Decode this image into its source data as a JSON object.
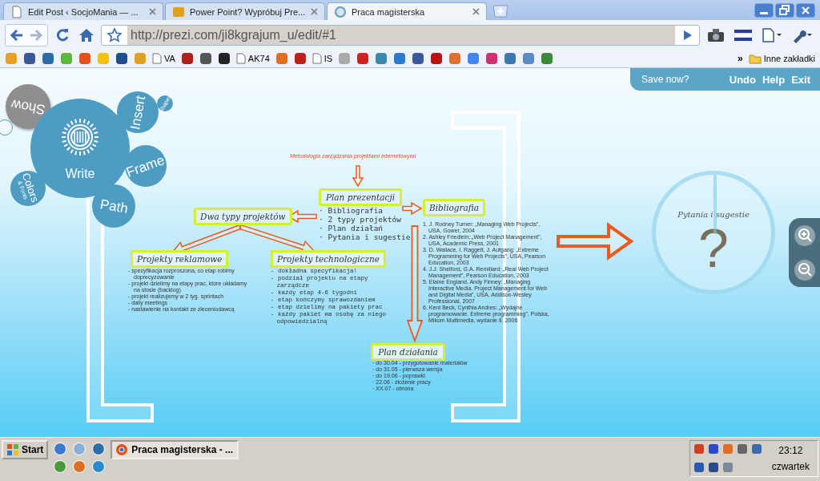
{
  "browser": {
    "tabs": [
      {
        "label": "Edit Post ‹ SocjoMania — ...",
        "selected": false
      },
      {
        "label": "Power Point? Wypróbuj Pre...",
        "selected": false
      },
      {
        "label": "Praca magisterska",
        "selected": true
      }
    ],
    "address": "http://prezi.com/ji8kgrajum_u/edit/#1",
    "bookmarks": [
      {
        "kind": "icon",
        "color": "#e8a020"
      },
      {
        "kind": "icon",
        "color": "#3b5998"
      },
      {
        "kind": "icon",
        "color": "#2a6ea8"
      },
      {
        "kind": "icon",
        "color": "#5cb83a"
      },
      {
        "kind": "icon",
        "color": "#e8501a"
      },
      {
        "kind": "icon",
        "color": "#f4c20d"
      },
      {
        "kind": "icon",
        "color": "#1c4f8c"
      },
      {
        "kind": "icon",
        "color": "#e0a020"
      },
      {
        "kind": "page",
        "label": "VA"
      },
      {
        "kind": "icon",
        "color": "#b0201a"
      },
      {
        "kind": "icon",
        "color": "#555555"
      },
      {
        "kind": "icon",
        "color": "#222222"
      },
      {
        "kind": "page",
        "label": "AK74"
      },
      {
        "kind": "icon",
        "color": "#e07020"
      },
      {
        "kind": "icon",
        "color": "#c0201a"
      },
      {
        "kind": "page",
        "label": "IS"
      },
      {
        "kind": "icon",
        "color": "#aaaaaa"
      },
      {
        "kind": "icon",
        "color": "#d02020"
      },
      {
        "kind": "icon",
        "color": "#3a8ab0"
      },
      {
        "kind": "icon",
        "color": "#2a7ad0"
      },
      {
        "kind": "icon",
        "color": "#3a5aa0"
      },
      {
        "kind": "icon",
        "color": "#c01010"
      },
      {
        "kind": "icon",
        "color": "#e07030"
      },
      {
        "kind": "icon",
        "color": "#4285f4"
      },
      {
        "kind": "icon",
        "color": "#d03070"
      },
      {
        "kind": "icon",
        "color": "#3a7ab0"
      },
      {
        "kind": "icon",
        "color": "#5a8ac8"
      },
      {
        "kind": "icon",
        "color": "#3a8a3a"
      }
    ],
    "overflow": "»",
    "other_bookmarks": "Inne zakładki"
  },
  "prezi": {
    "menu": [
      {
        "kind": "show",
        "label": "Show"
      },
      {
        "kind": "write",
        "label": "Write"
      },
      {
        "kind": "insert",
        "label": "Insert"
      },
      {
        "kind": "shapes",
        "label": "Shapes"
      },
      {
        "kind": "frame",
        "label": "Frame"
      },
      {
        "kind": "path",
        "label": "Path"
      },
      {
        "kind": "colors",
        "label": "Colors",
        "sublabel": "& Fonts"
      },
      {
        "kind": "import"
      }
    ],
    "save_prompt": "Save now?",
    "actions": [
      "Undo",
      "Help",
      "Exit"
    ],
    "subtitle": "Metodologia zarządzania projektami internetowymi",
    "frames": [
      {
        "kind": "agenda",
        "title": "Plan prezentacji",
        "items": [
          "· Bibliografia",
          "· 2 typy projektów",
          "· Plan działań",
          "· Pytania i sugestie"
        ]
      },
      {
        "kind": "bibliography",
        "title": "Bibliografia",
        "items": [
          "1. J. Rodney Turner: „Managing Web Projects”, USA, Gower, 2004",
          "2. Ashley Friedlein: „Web Project Management”, USA, Academic Press, 2001",
          "3. D. Wallace, I. Raggett, J. Aufgang: „Extreme Programming for Web Projects”, USA, Pearson Education, 2003",
          "4. J.J. Shelford, G.A. Remillard: „Real Web Project Management”, Pearson Education, 2003",
          "5. Elaine England, Andy Finney: „Managing Interactive Media. Project Management for Web and Digital Media”, USA, Addison-Wesley Professional, 2007",
          "6. Kent Beck, Cynthia Andres: „Wydajne programowanie. Extreme programming”, Polska, Mikom Multimedia, wydanie II, 2006"
        ]
      },
      {
        "kind": "types",
        "title": "Dwa typy projektów"
      },
      {
        "kind": "ads",
        "title": "Projekty reklamowe",
        "items": [
          "- specyfikacja rozproszona, co etap robimy doprecyzowanie",
          "- projekt dzielimy na etapy prac, które układamy na stosie (backlog)",
          "- projekt realizujemy w 2 tyg. sprintach",
          "- daily meetings",
          "- nastawienie na kontakt ze zleceniodawcą"
        ]
      },
      {
        "kind": "tech",
        "title": "Projekty technologiczne",
        "items": [
          "- dokładna specyfikacja!",
          "- podział projektu na etapy zarządcze",
          "- każdy etap 4-6 tygodni",
          "- etap kończymy sprawozdaniem",
          "- etap dzielimy na pakiety prac",
          "- każdy pakiet ma osobę za niego odpowiedzialną"
        ]
      },
      {
        "kind": "schedule",
        "title": "Plan działania",
        "items": [
          "· do 30.04 - przygotowanie materiałów",
          "· do 31.05 - pierwsza wersja",
          "· do 19.06 - poprawki",
          "· 22.06 - złożenie pracy",
          "· XX.07 - obrona"
        ]
      }
    ],
    "question": {
      "title": "Pytania i sugestie",
      "symbol": "?"
    }
  },
  "taskbar": {
    "start": "Start",
    "windows": [
      {
        "label": "Praca magisterska - ...",
        "selected": true
      }
    ],
    "time": "23:12",
    "day": "czwartek"
  }
}
